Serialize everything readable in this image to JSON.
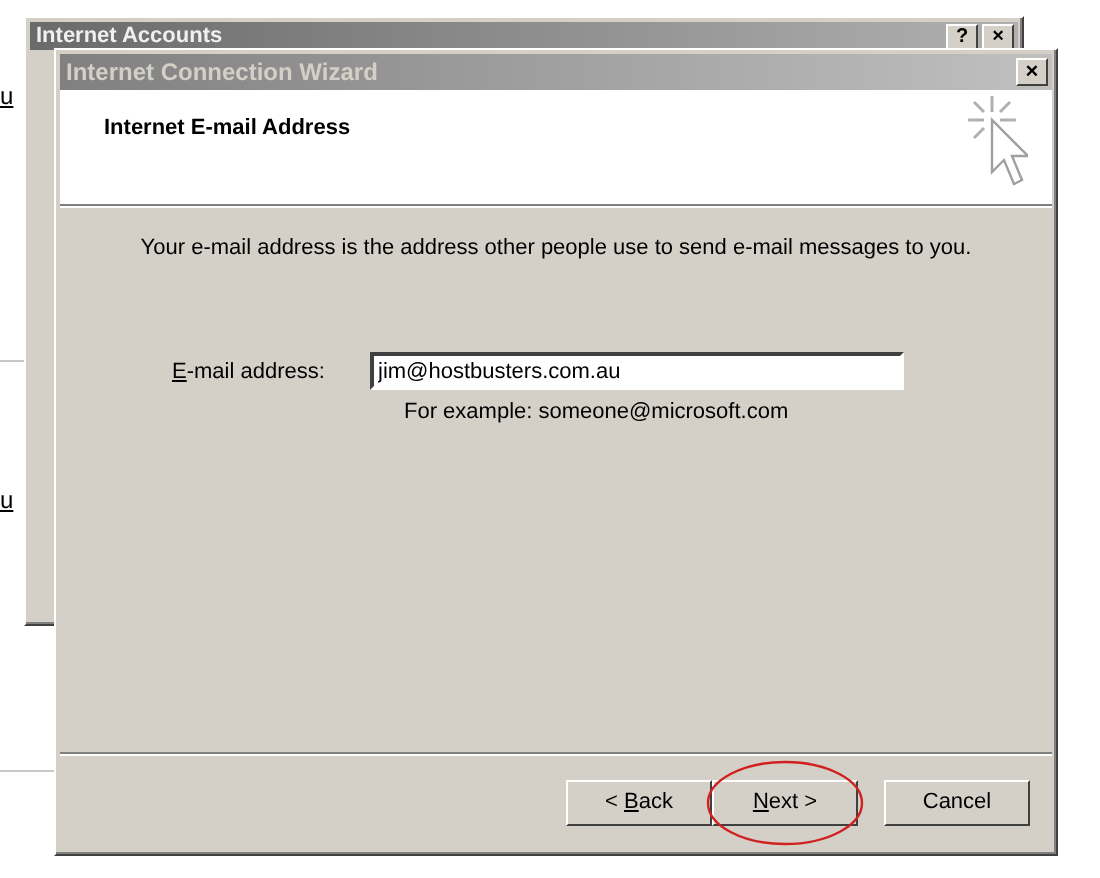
{
  "page_links": [
    "u",
    "u"
  ],
  "back_window": {
    "title": "Internet Accounts",
    "buttons": [
      "?",
      "×"
    ]
  },
  "wizard": {
    "title": "Internet Connection Wizard",
    "close": "×",
    "heading": "Internet E-mail Address",
    "description": "Your e-mail address is the address other people use to send e-mail messages to you.",
    "field": {
      "label": {
        "key": "E",
        "rest": "-mail address:"
      },
      "value": "jim@hostbusters.com.au",
      "hint": "For example: someone@microsoft.com"
    },
    "buttons": [
      {
        "label": {
          "prefix": "< ",
          "key": "B",
          "rest": "ack"
        },
        "highlighted": false
      },
      {
        "label": {
          "key": "N",
          "rest": "ext >"
        },
        "highlighted": true
      },
      {
        "label": {
          "prefix": "Cancel"
        },
        "highlighted": false
      }
    ]
  }
}
